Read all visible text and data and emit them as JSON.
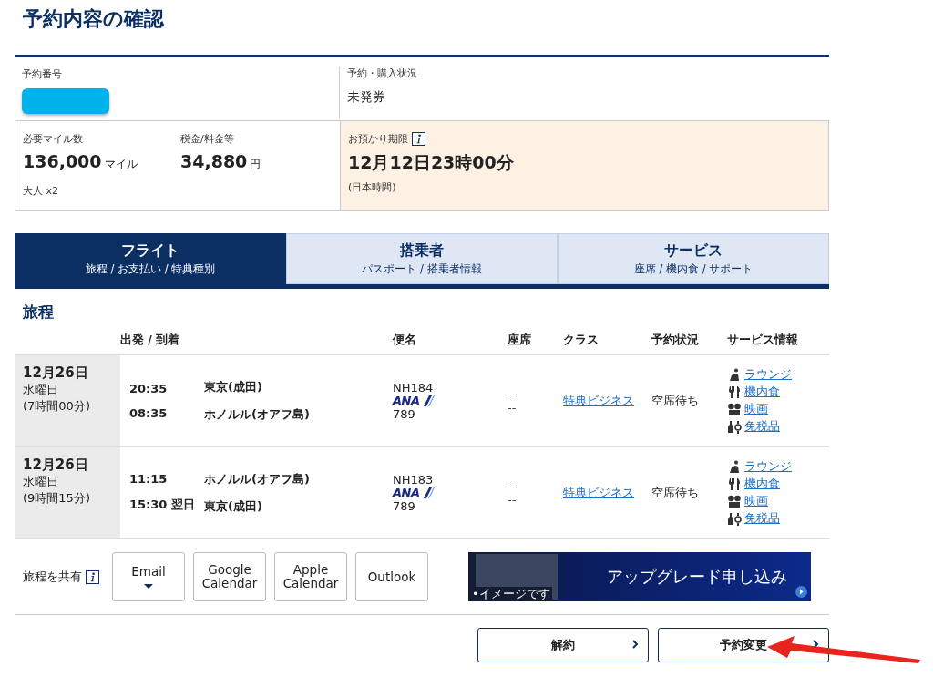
{
  "page_title": "予約内容の確認",
  "summary": {
    "booking_number": {
      "label": "予約番号"
    },
    "status": {
      "label": "予約・購入状況",
      "value": "未発券"
    },
    "miles": {
      "label": "必要マイル数",
      "value": "136,000",
      "unit": "マイル"
    },
    "tax": {
      "label": "税金/料金等",
      "value": "34,880",
      "unit": "円"
    },
    "passengers": "大人 x2",
    "deadline": {
      "label": "お預かり期限",
      "value": "12月12日23時00分",
      "note": "(日本時間)"
    }
  },
  "tabs": [
    {
      "title": "フライト",
      "subtitle": "旅程 / お支払い / 特典種別",
      "selected": true
    },
    {
      "title": "搭乗者",
      "subtitle": "パスポート / 搭乗者情報",
      "selected": false
    },
    {
      "title": "サービス",
      "subtitle": "座席 / 機内食 / サポート",
      "selected": false
    }
  ],
  "itinerary": {
    "title": "旅程",
    "columns": [
      "出発 / 到着",
      "便名",
      "座席",
      "クラス",
      "予約状況",
      "サービス情報"
    ],
    "rows": [
      {
        "date": "12月26日",
        "weekday": "水曜日",
        "duration": "(7時間00分)",
        "segments": [
          {
            "time": "20:35",
            "place": "東京(成田)"
          },
          {
            "time": "08:35",
            "place": "ホノルル(オアフ島)"
          }
        ],
        "flight": "NH184",
        "airline_logo": "ANA",
        "aircraft": "789",
        "seats": [
          "--",
          "--"
        ],
        "class": "特典ビジネス",
        "status": "空席待ち",
        "services": [
          {
            "kind": "lounge",
            "label": "ラウンジ"
          },
          {
            "kind": "meal",
            "label": "機内食"
          },
          {
            "kind": "movie",
            "label": "映画"
          },
          {
            "kind": "dutyfree",
            "label": "免税品"
          }
        ]
      },
      {
        "date": "12月26日",
        "weekday": "水曜日",
        "duration": "(9時間15分)",
        "segments": [
          {
            "time": "11:15",
            "place": "ホノルル(オアフ島)"
          },
          {
            "time": "15:30 翌日",
            "place": "東京(成田)"
          }
        ],
        "flight": "NH183",
        "airline_logo": "ANA",
        "aircraft": "789",
        "seats": [
          "--",
          "--"
        ],
        "class": "特典ビジネス",
        "status": "空席待ち",
        "services": [
          {
            "kind": "lounge",
            "label": "ラウンジ"
          },
          {
            "kind": "meal",
            "label": "機内食"
          },
          {
            "kind": "movie",
            "label": "映画"
          },
          {
            "kind": "dutyfree",
            "label": "免税品"
          }
        ]
      }
    ]
  },
  "share": {
    "label": "旅程を共有",
    "buttons": [
      {
        "label": "Email",
        "dropdown": true
      },
      {
        "label": "Google Calendar",
        "dropdown": false
      },
      {
        "label": "Apple Calendar",
        "dropdown": false
      },
      {
        "label": "Outlook",
        "dropdown": false
      }
    ]
  },
  "upgrade_banner": {
    "text": "アップグレード申し込み",
    "caption": "•イメージです"
  },
  "actions": [
    {
      "label": "解約"
    },
    {
      "label": "予約変更"
    }
  ]
}
